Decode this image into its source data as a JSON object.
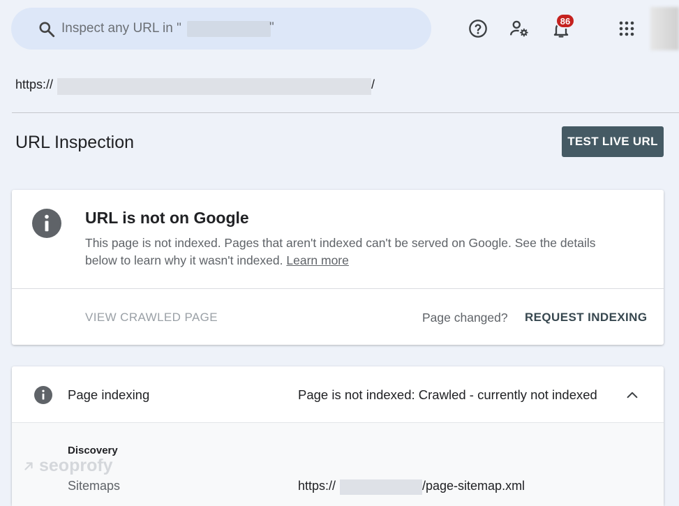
{
  "search": {
    "placeholder": "Inspect any URL in \"",
    "quote_open": "\"",
    "quote_close": "\""
  },
  "header_icons": [
    "search-icon",
    "help-icon",
    "user-settings-icon",
    "notifications-icon",
    "apps-grid-icon"
  ],
  "notifications": {
    "count": "86"
  },
  "inspected_url": {
    "prefix": "https://",
    "suffix": "/"
  },
  "page": {
    "title": "URL Inspection",
    "test_live_url": "TEST LIVE URL"
  },
  "status_card": {
    "title": "URL is not on Google",
    "description": "This page is not indexed. Pages that aren't indexed can't be served on Google. See the details below to learn why it wasn't indexed.",
    "learn_more": "Learn more",
    "view_crawled_page": "VIEW CRAWLED PAGE",
    "page_changed": "Page changed?",
    "request_indexing": "REQUEST INDEXING"
  },
  "indexing_card": {
    "title": "Page indexing",
    "status": "Page is not indexed: Crawled - currently not indexed",
    "section_label": "Discovery",
    "sitemaps_label": "Sitemaps",
    "sitemap_prefix": "https://",
    "sitemap_suffix": "/page-sitemap.xml"
  },
  "watermark": "seoprofy",
  "colors": {
    "background": "#eef2f9",
    "search_bg": "#dde7f8",
    "primary_button": "#455a64",
    "badge": "#c5221f",
    "info_icon": "#5f6368"
  }
}
